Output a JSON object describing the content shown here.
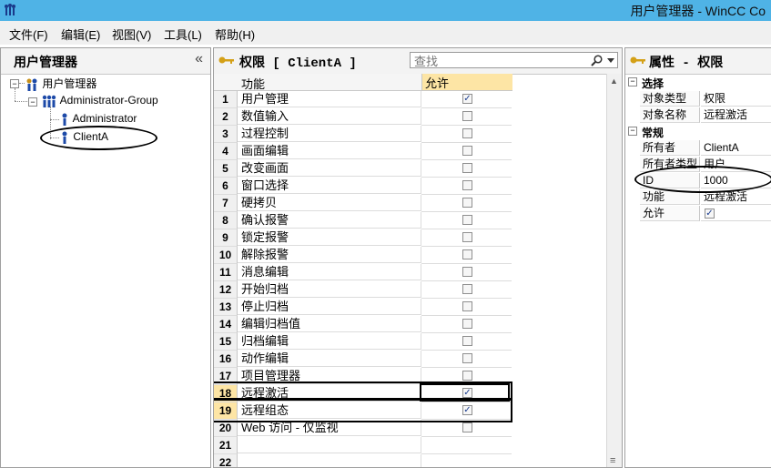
{
  "window": {
    "title": "用户管理器 - WinCC Co"
  },
  "menu": [
    {
      "label": "文件(F)"
    },
    {
      "label": "编辑(E)"
    },
    {
      "label": "视图(V)"
    },
    {
      "label": "工具(L)"
    },
    {
      "label": "帮助(H)"
    }
  ],
  "left_panel": {
    "title": "用户管理器",
    "collapse_glyph": "«",
    "tree": {
      "root": "用户管理器",
      "group": "Administrator-Group",
      "users": [
        "Administrator",
        "ClientA"
      ]
    }
  },
  "middle_panel": {
    "title": "权限 [ ClientA ]",
    "search_placeholder": "查找",
    "columns": {
      "function": "功能",
      "allow": "允许"
    },
    "rows": [
      {
        "num": "1",
        "name": "用户管理",
        "allowed": true
      },
      {
        "num": "2",
        "name": "数值输入",
        "allowed": false
      },
      {
        "num": "3",
        "name": "过程控制",
        "allowed": false
      },
      {
        "num": "4",
        "name": "画面编辑",
        "allowed": false
      },
      {
        "num": "5",
        "name": "改变画面",
        "allowed": false
      },
      {
        "num": "6",
        "name": "窗口选择",
        "allowed": false
      },
      {
        "num": "7",
        "name": "硬拷贝",
        "allowed": false
      },
      {
        "num": "8",
        "name": "确认报警",
        "allowed": false
      },
      {
        "num": "9",
        "name": "锁定报警",
        "allowed": false
      },
      {
        "num": "10",
        "name": "解除报警",
        "allowed": false
      },
      {
        "num": "11",
        "name": "消息编辑",
        "allowed": false
      },
      {
        "num": "12",
        "name": "开始归档",
        "allowed": false
      },
      {
        "num": "13",
        "name": "停止归档",
        "allowed": false
      },
      {
        "num": "14",
        "name": "编辑归档值",
        "allowed": false
      },
      {
        "num": "15",
        "name": "归档编辑",
        "allowed": false
      },
      {
        "num": "16",
        "name": "动作编辑",
        "allowed": false
      },
      {
        "num": "17",
        "name": "项目管理器",
        "allowed": false
      },
      {
        "num": "18",
        "name": "远程激活",
        "allowed": true
      },
      {
        "num": "19",
        "name": "远程组态",
        "allowed": true
      },
      {
        "num": "20",
        "name": "Web 访问 - 仅监视",
        "allowed": false
      },
      {
        "num": "21",
        "name": "",
        "allowed": null
      },
      {
        "num": "22",
        "name": "",
        "allowed": null
      }
    ]
  },
  "right_panel": {
    "title": "属性 - 权限",
    "sections": [
      {
        "name": "选择",
        "props": [
          {
            "key": "对象类型",
            "value": "权限"
          },
          {
            "key": "对象名称",
            "value": "远程激活"
          }
        ]
      },
      {
        "name": "常规",
        "props": [
          {
            "key": "所有者",
            "value": "ClientA"
          },
          {
            "key": "所有者类型",
            "value": "用户"
          },
          {
            "key": "ID",
            "value": "1000"
          },
          {
            "key": "功能",
            "value": "远程激活"
          },
          {
            "key": "允许",
            "value": "✓",
            "checkbox": true
          }
        ]
      }
    ]
  },
  "colors": {
    "titlebar": "#4fb3e6",
    "highlight": "#fde5a5",
    "key_icon": "#d4a017"
  },
  "icons": [
    "app-icon",
    "user-group-icon",
    "user-icon",
    "key-icon",
    "search-icon",
    "dropdown-icon",
    "collapse-icon"
  ]
}
